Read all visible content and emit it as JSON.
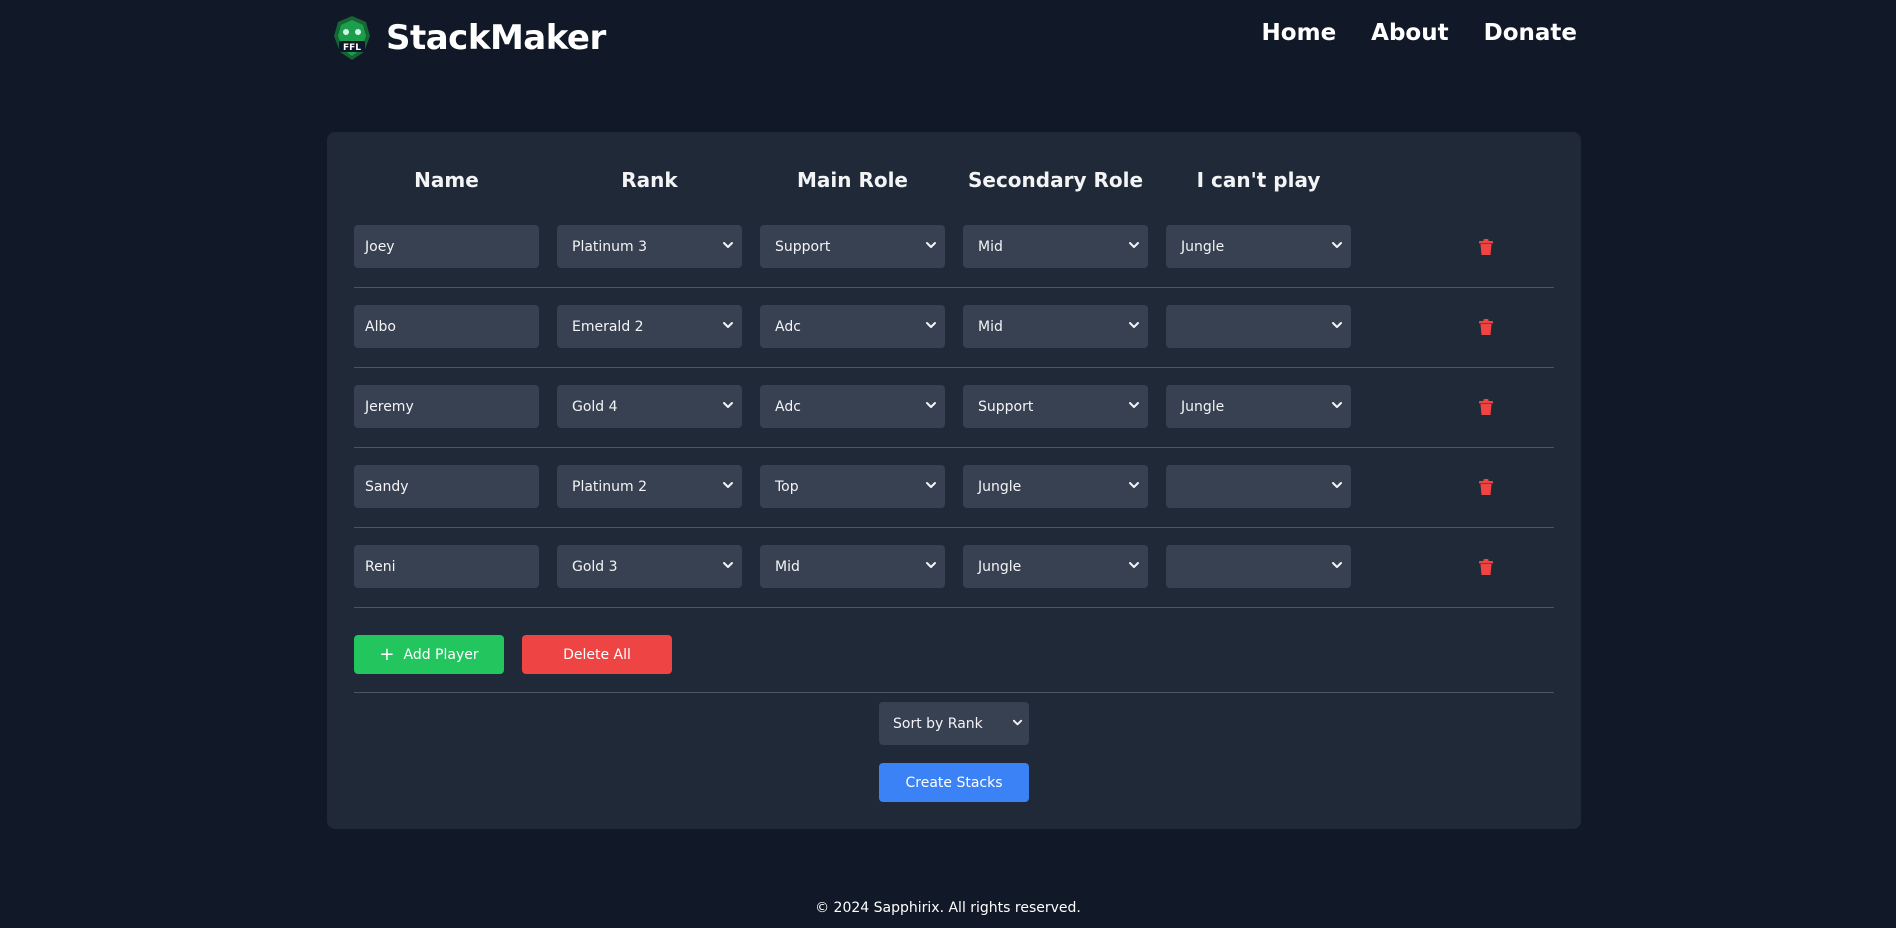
{
  "header": {
    "brand_name": "StackMaker",
    "nav": [
      "Home",
      "About",
      "Donate"
    ]
  },
  "table": {
    "columns": [
      "Name",
      "Rank",
      "Main Role",
      "Secondary Role",
      "I can't play"
    ],
    "rows": [
      {
        "name": "Joey",
        "rank": "Platinum 3",
        "main": "Support",
        "secondary": "Mid",
        "cant": "Jungle"
      },
      {
        "name": "Albo",
        "rank": "Emerald 2",
        "main": "Adc",
        "secondary": "Mid",
        "cant": ""
      },
      {
        "name": "Jeremy",
        "rank": "Gold 4",
        "main": "Adc",
        "secondary": "Support",
        "cant": "Jungle"
      },
      {
        "name": "Sandy",
        "rank": "Platinum 2",
        "main": "Top",
        "secondary": "Jungle",
        "cant": ""
      },
      {
        "name": "Reni",
        "rank": "Gold 3",
        "main": "Mid",
        "secondary": "Jungle",
        "cant": ""
      }
    ]
  },
  "actions": {
    "add_player": "Add Player",
    "delete_all": "Delete All",
    "sort": "Sort by Rank",
    "create_stacks": "Create Stacks"
  },
  "footer": {
    "copyright": "© 2024 Sapphirix. All rights reserved."
  },
  "colors": {
    "background": "#111827",
    "card": "#1f2937",
    "field": "#374151",
    "add": "#22c55e",
    "danger": "#ef4444",
    "primary": "#3b82f6"
  },
  "icons": {
    "logo": "ffl-dragon-logo",
    "delete": "trash-icon",
    "dropdown": "chevron-down-icon",
    "add": "plus-icon"
  }
}
